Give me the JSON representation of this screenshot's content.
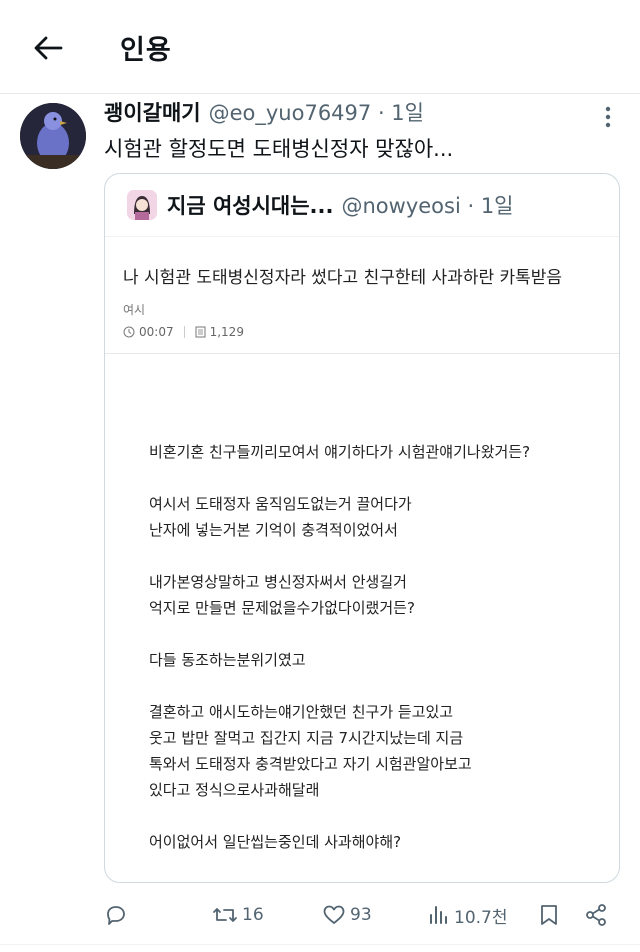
{
  "header": {
    "back_icon": "arrow-left-icon",
    "title": "인용"
  },
  "tweet": {
    "author_name": "괭이갈매기",
    "author_meta": "@eo_yuo76497 · 1일",
    "text": "시험관 할정도면 도태병신정자 맞잖아...",
    "more_icon": "more-vertical-icon",
    "quote": {
      "author_name": "지금 여성시대는...",
      "author_meta": "@nowyeosi · 1일",
      "post_title": "나 시험관 도태병신정자라 썼다고 친구한테 사과하란 카톡받음",
      "board": "여시",
      "time": "00:07",
      "views": "1,129",
      "body_lines": [
        "비혼기혼 친구들끼리모여서 얘기하다가 시험관얘기나왔거든?",
        "여시서 도태정자 움직임도없는거 끌어다가",
        "난자에 넣는거본 기억이 충격적이었어서",
        "내가본영상말하고 병신정자써서 안생길거",
        "억지로 만들면 문제없을수가없다이랬거든?",
        "다들 동조하는분위기였고",
        "결혼하고 애시도하는얘기안했던 친구가 듣고있고",
        "웃고 밥만 잘먹고 집간지 지금 7시간지났는데 지금",
        "톡와서 도태정자 충격받았다고 자기 시험관알아보고",
        "있다고 정식으로사과해달래",
        "어이없어서 일단씹는중인데 사과해야해?"
      ]
    },
    "actions": {
      "reply_icon": "reply-icon",
      "retweets": "16",
      "likes": "93",
      "views": "10.7천",
      "bookmark_icon": "bookmark-icon",
      "share_icon": "share-icon"
    }
  },
  "colors": {
    "text": "#0f1419",
    "secondary": "#536471",
    "border": "#cfd9de"
  }
}
